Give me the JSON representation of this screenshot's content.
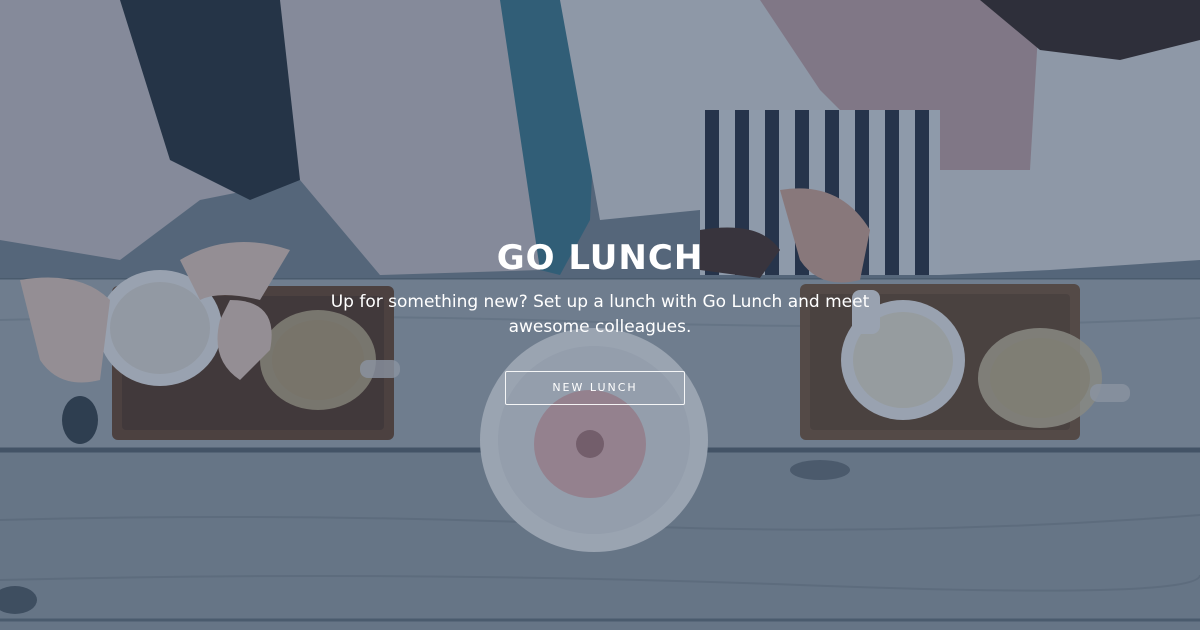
{
  "hero": {
    "title": "GO LUNCH",
    "subtitle": "Up for something new? Set up a lunch with Go Lunch and meet awesome colleagues.",
    "cta_label": "NEW LUNCH",
    "overlay_color": "#1e3450"
  },
  "background_image": {
    "subject": "overhead view of two people at a wooden table with cups, glass jugs, trays and a donut"
  }
}
